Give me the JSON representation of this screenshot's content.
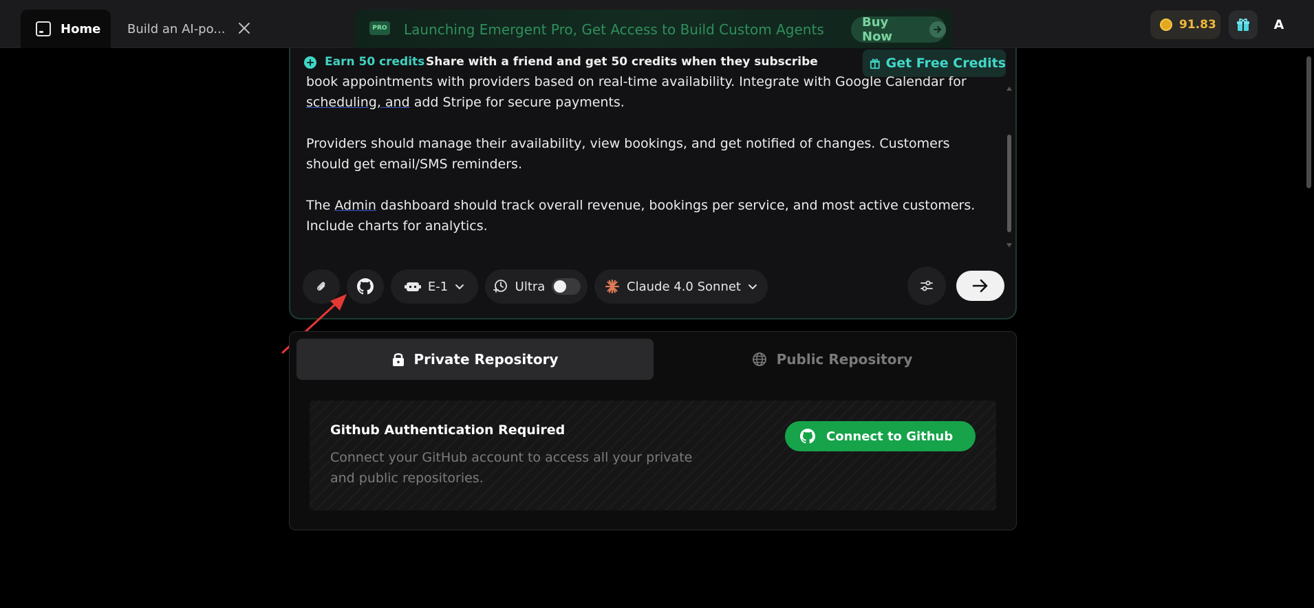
{
  "tabs": {
    "home": "Home",
    "build": "Build an AI-po..."
  },
  "promo": {
    "badge": "PRO",
    "text": "Launching Emergent Pro, Get Access to Build Custom Agents",
    "button": "Buy Now"
  },
  "header": {
    "credits": "91.83",
    "avatar_initial": "A"
  },
  "share": {
    "earn": "Earn 50 credits",
    "text": "Share with a friend and get 50 credits when they subscribe",
    "button": "Get Free Credits"
  },
  "prompt": {
    "line1a": "book appointments with providers based on real-time availability. Integrate with Google Calendar for",
    "line1b_underlined": "scheduling, and",
    "line1c": " add Stripe for secure payments.",
    "para2": "Providers should manage their availability, view bookings, and get notified of changes. Customers should get email/SMS reminders.",
    "para3a": "The ",
    "para3_underlined": "Admin",
    "para3b": " dashboard should track overall revenue, bookings per service, and most active customers. Include charts for analytics."
  },
  "toolbar": {
    "agent": "E-1",
    "ultra": "Ultra",
    "model": "Claude 4.0 Sonnet"
  },
  "repo": {
    "private_tab": "Private Repository",
    "public_tab": "Public Repository",
    "auth_title": "Github Authentication Required",
    "auth_desc": "Connect your GitHub account to access all your private and public repositories.",
    "connect_button": "Connect to Github"
  },
  "colors": {
    "accent_teal": "#41d2c1",
    "github_green": "#16a34a",
    "coin_gold": "#f0b93a",
    "annotation_red": "#e53935"
  }
}
